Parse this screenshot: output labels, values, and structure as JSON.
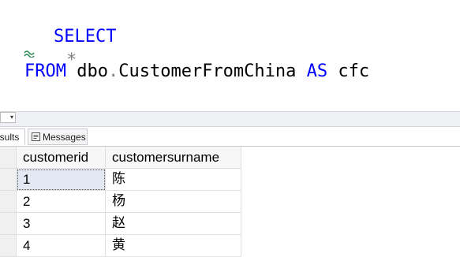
{
  "editor": {
    "select_kw": "SELECT",
    "star": "*",
    "from_kw": "FROM",
    "schema": "dbo",
    "dot": ".",
    "table": "CustomerFromChina",
    "as_kw": "AS",
    "alias": "cfc"
  },
  "toolbar": {
    "zoom_arrow": "▾"
  },
  "tabs": {
    "results_label": "esults",
    "messages_label": "Messages"
  },
  "grid": {
    "columns": [
      "customerid",
      "customersurname"
    ],
    "rows": [
      [
        "1",
        "陈"
      ],
      [
        "2",
        "杨"
      ],
      [
        "3",
        "赵"
      ],
      [
        "4",
        "黄"
      ]
    ]
  },
  "colors": {
    "keyword": "#0000ff",
    "operator": "#808080",
    "squiggle": "#2e8b57",
    "selected_cell_bg": "#e3e8f2"
  }
}
